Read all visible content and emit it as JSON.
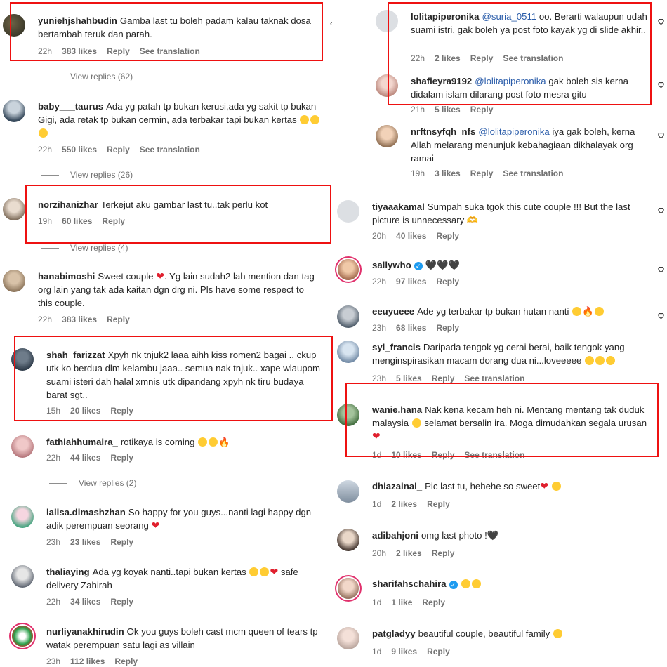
{
  "left": [
    {
      "user": "yuniehjshahbudin",
      "text": "Gamba last tu boleh padam kalau taknak dosa bertambah teruk dan parah.",
      "time": "22h",
      "likes": "383 likes",
      "reply": "Reply",
      "translate": "See translation",
      "view_replies": "View replies (62)"
    },
    {
      "user": "baby___taurus",
      "text": "Ada yg patah tp bukan kerusi,ada yg sakit tp bukan Gigi, ada retak tp bukan cermin, ada terbakar tapi bukan kertas",
      "time": "22h",
      "likes": "550 likes",
      "reply": "Reply",
      "translate": "See translation",
      "view_replies": "View replies (26)"
    },
    {
      "user": "norzihanizhar",
      "text": "Terkejut aku gambar last tu..tak perlu kot",
      "time": "19h",
      "likes": "60 likes",
      "reply": "Reply",
      "view_replies": "View replies (4)"
    },
    {
      "user": "hanabimoshi",
      "text": "Sweet couple",
      "text2": ". Yg lain sudah2 lah mention dan tag org lain yang tak ada kaitan dgn drg ni. Pls have some respect to this couple.",
      "time": "22h",
      "likes": "383 likes",
      "reply": "Reply"
    },
    {
      "user": "shah_farizzat",
      "text": "Xpyh nk tnjuk2 laaa aihh kiss romen2 bagai .. ckup utk ko berdua dlm kelambu jaaa.. semua nak tnjuk.. xape wlaupom suami isteri dah halal xmnis utk dipandang xpyh nk tiru budaya barat sgt..",
      "time": "15h",
      "likes": "20 likes",
      "reply": "Reply"
    },
    {
      "user": "fathiahhumaira_",
      "text": "rotikaya is coming",
      "time": "22h",
      "likes": "44 likes",
      "reply": "Reply",
      "view_replies": "View replies (2)"
    },
    {
      "user": "lalisa.dimashzhan",
      "text": "So happy for you guys...nanti lagi happy dgn adik perempuan seorang",
      "time": "23h",
      "likes": "23 likes",
      "reply": "Reply"
    },
    {
      "user": "thaliaying",
      "text": "Ada yg koyak nanti..tapi bukan kertas",
      "text2": "safe delivery Zahirah",
      "time": "22h",
      "likes": "34 likes",
      "reply": "Reply"
    },
    {
      "user": "nurliyanakhirudin",
      "text": "Ok you guys boleh cast mcm queen of tears tp watak perempuan satu lagi as villain",
      "time": "23h",
      "likes": "112 likes",
      "reply": "Reply"
    }
  ],
  "right": [
    {
      "user": "lolitapiperonika",
      "mention": "@suria_0511",
      "text": "oo. Berarti walaupun udah suami istri, gak boleh ya post foto kayak yg di slide akhir..",
      "time": "22h",
      "likes": "2 likes",
      "reply": "Reply",
      "translate": "See translation"
    },
    {
      "user": "shafieyra9192",
      "mention": "@lolitapiperonika",
      "text": "gak boleh sis kerna didalam islam dilarang post foto mesra gitu",
      "time": "21h",
      "likes": "5 likes",
      "reply": "Reply"
    },
    {
      "user": "nrftnsyfqh_nfs",
      "mention": "@lolitapiperonika",
      "text": "iya gak boleh, kerna Allah melarang menunjuk kebahagiaan dikhalayak org ramai",
      "time": "19h",
      "likes": "3 likes",
      "reply": "Reply",
      "translate": "See translation"
    },
    {
      "user": "tiyaaakamal",
      "text": "Sumpah suka tgok this cute couple !!! But the last picture is unnecessary 🫶",
      "time": "20h",
      "likes": "40 likes",
      "reply": "Reply"
    },
    {
      "user": "sallywho",
      "text": "🖤🖤🖤",
      "time": "22h",
      "likes": "97 likes",
      "reply": "Reply"
    },
    {
      "user": "eeuyueee",
      "text": "Ade yg terbakar tp bukan hutan nanti",
      "time": "23h",
      "likes": "68 likes",
      "reply": "Reply"
    },
    {
      "user": "syl_francis",
      "text": "Daripada tengok yg cerai berai, baik tengok yang menginspirasikan macam dorang dua ni...loveeeee",
      "time": "23h",
      "likes": "5 likes",
      "reply": "Reply",
      "translate": "See translation"
    },
    {
      "user": "wanie.hana",
      "text": "Nak kena kecam heh ni. Mentang mentang tak duduk malaysia",
      "text2": "selamat bersalin ira. Moga dimudahkan segala urusan",
      "time": "1d",
      "likes": "10 likes",
      "reply": "Reply",
      "translate": "See translation"
    },
    {
      "user": "dhiazainal_",
      "text": "Pic last tu, hehehe so sweet",
      "time": "1d",
      "likes": "2 likes",
      "reply": "Reply"
    },
    {
      "user": "adibahjoni",
      "text": "omg last photo !🖤",
      "time": "20h",
      "likes": "2 likes",
      "reply": "Reply"
    },
    {
      "user": "sharifahschahira",
      "text": "",
      "time": "1d",
      "likes": "1 like",
      "reply": "Reply"
    },
    {
      "user": "patgladyy",
      "text": "beautiful couple, beautiful family",
      "time": "1d",
      "likes": "9 likes",
      "reply": "Reply"
    }
  ],
  "colors": {
    "highlight": "#e11111",
    "mention": "#2b5daa",
    "meta": "#737373"
  }
}
